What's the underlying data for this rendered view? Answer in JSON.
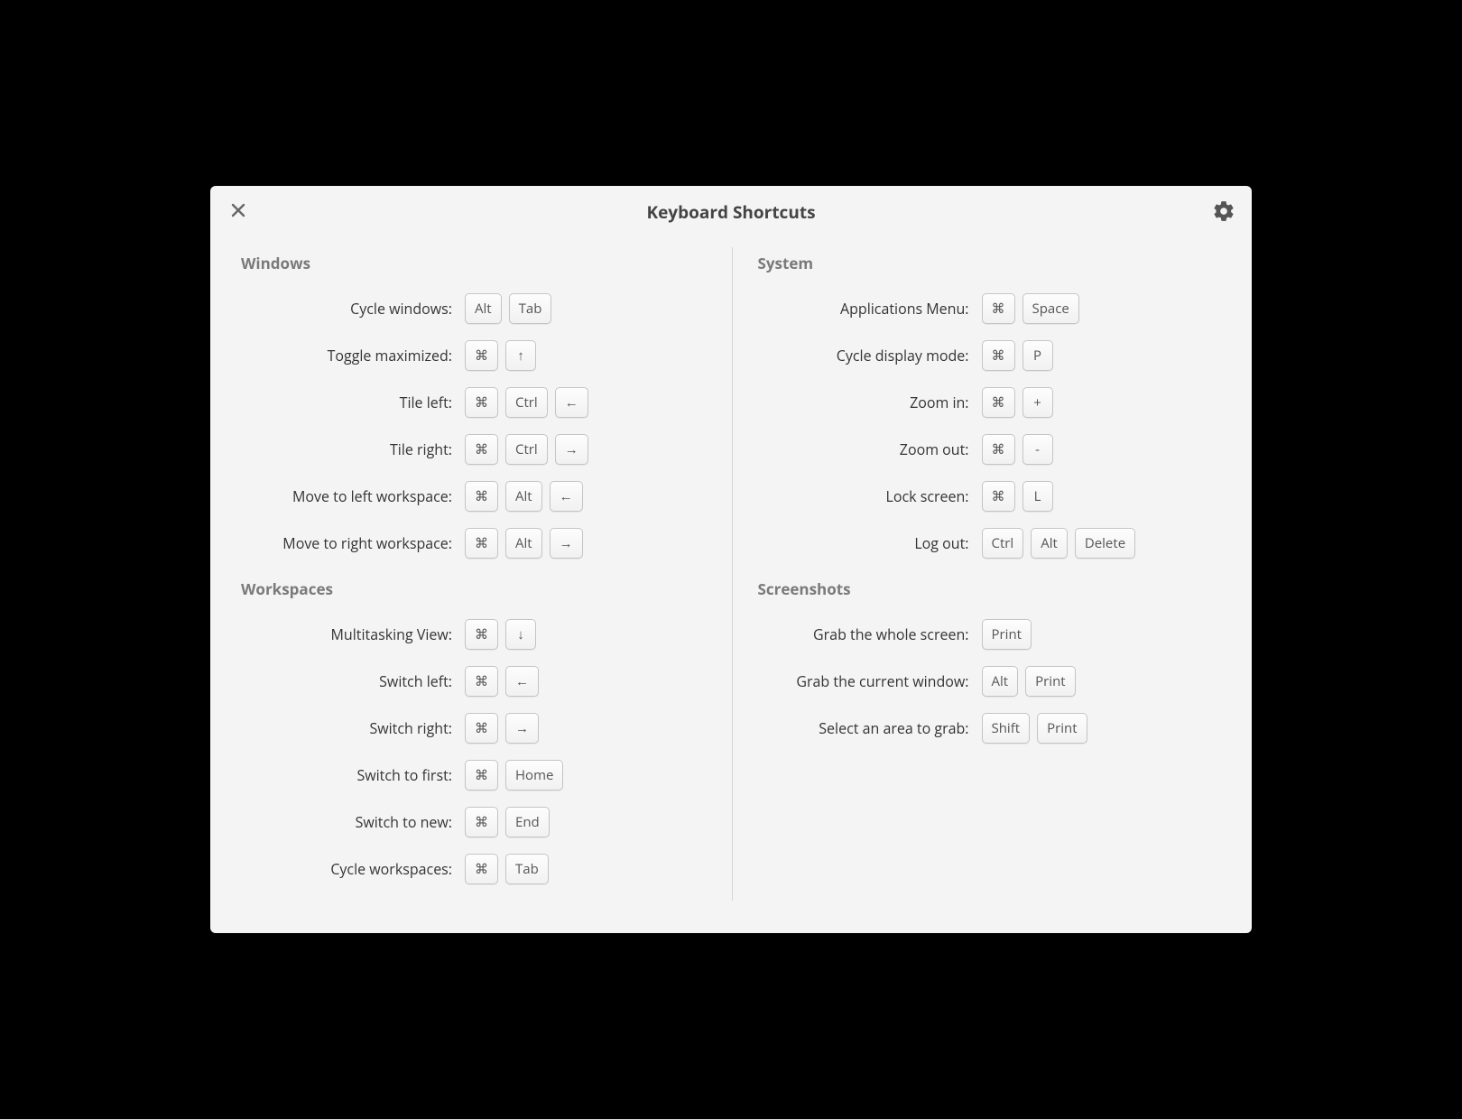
{
  "dialog": {
    "title": "Keyboard Shortcuts"
  },
  "left": {
    "sections": [
      {
        "title": "Windows",
        "rows": [
          {
            "label": "Cycle windows:",
            "keys": [
              "Alt",
              "Tab"
            ]
          },
          {
            "label": "Toggle maximized:",
            "keys": [
              "⌘",
              "↑"
            ]
          },
          {
            "label": "Tile left:",
            "keys": [
              "⌘",
              "Ctrl",
              "←"
            ]
          },
          {
            "label": "Tile right:",
            "keys": [
              "⌘",
              "Ctrl",
              "→"
            ]
          },
          {
            "label": "Move to left workspace:",
            "keys": [
              "⌘",
              "Alt",
              "←"
            ]
          },
          {
            "label": "Move to right workspace:",
            "keys": [
              "⌘",
              "Alt",
              "→"
            ]
          }
        ]
      },
      {
        "title": "Workspaces",
        "rows": [
          {
            "label": "Multitasking View:",
            "keys": [
              "⌘",
              "↓"
            ]
          },
          {
            "label": "Switch left:",
            "keys": [
              "⌘",
              "←"
            ]
          },
          {
            "label": "Switch right:",
            "keys": [
              "⌘",
              "→"
            ]
          },
          {
            "label": "Switch to first:",
            "keys": [
              "⌘",
              "Home"
            ]
          },
          {
            "label": "Switch to new:",
            "keys": [
              "⌘",
              "End"
            ]
          },
          {
            "label": "Cycle workspaces:",
            "keys": [
              "⌘",
              "Tab"
            ]
          }
        ]
      }
    ]
  },
  "right": {
    "sections": [
      {
        "title": "System",
        "rows": [
          {
            "label": "Applications Menu:",
            "keys": [
              "⌘",
              "Space"
            ]
          },
          {
            "label": "Cycle display mode:",
            "keys": [
              "⌘",
              "P"
            ]
          },
          {
            "label": "Zoom in:",
            "keys": [
              "⌘",
              "+"
            ]
          },
          {
            "label": "Zoom out:",
            "keys": [
              "⌘",
              "-"
            ]
          },
          {
            "label": "Lock screen:",
            "keys": [
              "⌘",
              "L"
            ]
          },
          {
            "label": "Log out:",
            "keys": [
              "Ctrl",
              "Alt",
              "Delete"
            ]
          }
        ]
      },
      {
        "title": "Screenshots",
        "rows": [
          {
            "label": "Grab the whole screen:",
            "keys": [
              "Print"
            ]
          },
          {
            "label": "Grab the current window:",
            "keys": [
              "Alt",
              "Print"
            ]
          },
          {
            "label": "Select an area to grab:",
            "keys": [
              "Shift",
              "Print"
            ]
          }
        ]
      }
    ]
  }
}
